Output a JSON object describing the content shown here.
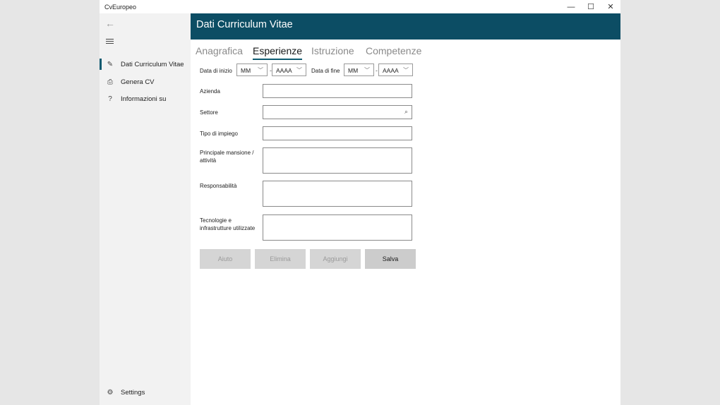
{
  "window": {
    "title": "CvEuropeo",
    "controls": {
      "minimize": "—",
      "maximize": "☐",
      "close": "✕"
    }
  },
  "sidebar": {
    "back_icon": "←",
    "items": [
      {
        "label": "Dati Curriculum Vitae",
        "icon": "✎",
        "active": true
      },
      {
        "label": "Genera CV",
        "icon": "⎙",
        "active": false
      },
      {
        "label": "Informazioni su",
        "icon": "?",
        "active": false
      }
    ],
    "settings": {
      "label": "Settings",
      "icon": "⚙"
    }
  },
  "header": {
    "title": "Dati Curriculum Vitae"
  },
  "tabs": [
    {
      "label": "Anagrafica",
      "active": false
    },
    {
      "label": "Esperienze",
      "active": true
    },
    {
      "label": "Istruzione",
      "active": false
    },
    {
      "label": "Competenze",
      "active": false
    }
  ],
  "form": {
    "start_date": {
      "label": "Data di inizio",
      "month": "MM",
      "year": "AAAA"
    },
    "end_date": {
      "label": "Data di fine",
      "month": "MM",
      "year": "AAAA"
    },
    "date_separator": "-",
    "fields": {
      "azienda": "Azienda",
      "settore": "Settore",
      "tipo_impiego": "Tipo di impiego",
      "mansione_line1": "Principale mansione /",
      "mansione_line2": "attività",
      "responsabilita": "Responsabilità",
      "tecnologie_line1": "Tecnologie e",
      "tecnologie_line2": "infrastrutture utilizzate"
    }
  },
  "buttons": {
    "aiuto": "Aiuto",
    "elimina": "Elimina",
    "aggiungi": "Aggiungi",
    "salva": "Salva"
  },
  "colors": {
    "header_bg": "#0c4d64",
    "accent": "#0e5a70",
    "sidebar_bg": "#f2f2f2"
  }
}
